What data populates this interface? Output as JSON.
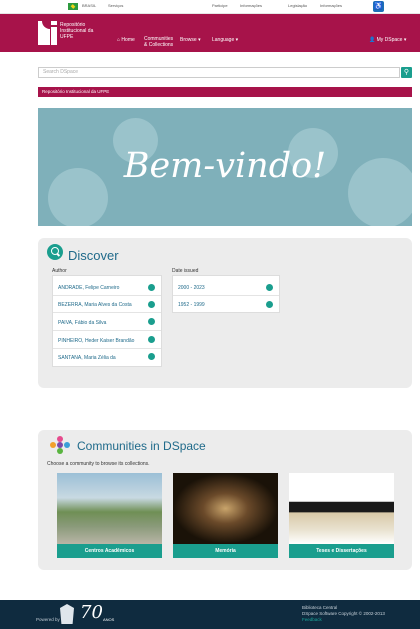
{
  "gov_bar": {
    "brasil": "BRASIL",
    "servicos": "Serviços",
    "links": [
      "Participe",
      "Informações",
      "Legislação",
      "Informações"
    ]
  },
  "header": {
    "logo_text": "Repositório Institucional da UFPE",
    "nav": {
      "home": "Home",
      "communities": "Communities & Collections",
      "browse": "Browse",
      "language": "Language",
      "user": "My DSpace"
    }
  },
  "search": {
    "placeholder": "Search DSpace"
  },
  "breadcrumb": "Repositório Institucional da UFPE",
  "hero": {
    "title": "Bem-vindo!"
  },
  "discover": {
    "title": "Discover",
    "author_label": "Author",
    "date_label": "Date issued",
    "authors": [
      {
        "name": "ANDRADE, Felipe Carneiro",
        "count": ""
      },
      {
        "name": "BEZERRA, Maria Alves da Costa",
        "count": ""
      },
      {
        "name": "PAIVA, Fábio da Silva",
        "count": ""
      },
      {
        "name": "PINHEIRO, Heder Kaiser Brandão",
        "count": ""
      },
      {
        "name": "SANTANA, Maria Zélia da",
        "count": ""
      }
    ],
    "dates": [
      {
        "range": "2000 - 2023",
        "count": ""
      },
      {
        "range": "1952 - 1999",
        "count": ""
      }
    ]
  },
  "communities": {
    "title": "Communities in DSpace",
    "subtitle": "Choose a community to browse its collections.",
    "cards": [
      {
        "label": "Centros Acadêmicos"
      },
      {
        "label": "Memória"
      },
      {
        "label": "Teses e Dissertações"
      }
    ]
  },
  "footer": {
    "left_label": "Powered by",
    "anniversary": "70",
    "anos": "ANOS",
    "right_line1": "Biblioteca Central",
    "right_line2": "DSpace Software Copyright © 2002-2013",
    "right_link": "Feedback"
  },
  "colors": {
    "brand": "#a7134a",
    "accent": "#1a9e8e",
    "footer": "#0f2b3f"
  }
}
